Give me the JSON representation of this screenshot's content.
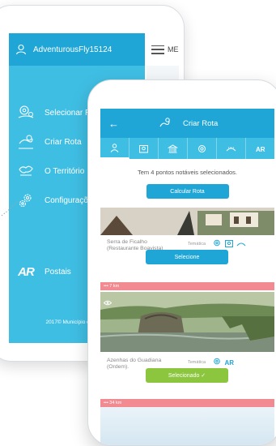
{
  "drawer": {
    "username": "AdventurousFly15124",
    "menu_peek": "ME",
    "items": [
      {
        "label": "Selecionar Rotas",
        "icon": "location-pins-icon"
      },
      {
        "label": "Criar Rota",
        "icon": "create-route-icon"
      },
      {
        "label": "O Território",
        "icon": "territory-map-icon"
      },
      {
        "label": "Configurações",
        "icon": "gears-icon"
      }
    ],
    "postais": {
      "label": "Postais",
      "icon_text": "AR"
    },
    "copyright": "2017© Município de Serpa"
  },
  "route": {
    "back_symbol": "←",
    "title": "Criar Rota",
    "tabs": [
      "person-icon",
      "map-pin-icon",
      "monument-icon",
      "target-icon",
      "road-icon",
      "ar-icon"
    ],
    "selected_text": "Tem 4 pontos notáveis selecionados.",
    "calc_button": "Calcular Rota",
    "poi1": {
      "name": "Serra de Ficalho (Restaurante Boavista)",
      "category": "Temática",
      "button": "Selecione"
    },
    "distance1": "••• 7 km",
    "poi2": {
      "name": "Azenhas do Guadiana (Ordem).",
      "category": "Temática",
      "button": "Selecionado ✓"
    },
    "distance2": "••• 34 km"
  },
  "colors": {
    "primary": "#1fa6d6",
    "drawer": "#3fbee3",
    "selected": "#8cc63f",
    "distance_bar": "#f28a92"
  }
}
